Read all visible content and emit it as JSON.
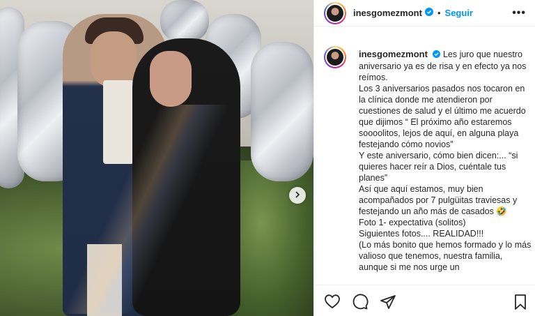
{
  "post": {
    "username": "inesgomezmont",
    "follow_label": "Seguir",
    "more_label": "•••",
    "verified_icon": "verified-badge-icon",
    "separator": "•"
  },
  "caption": {
    "lines": [
      "Les juro que nuestro aniversario ya es de risa y en efecto ya nos reímos.",
      "Los 3 aniversarios pasados nos tocaron en la clínica donde me atendieron por cuestiones de salud y el último me acuerdo que dijimos “ El próximo año estaremos soooolitos, lejos de aquí, en alguna playa festejando cómo novios”",
      "Y este aniversario, cómo bien dicen:... “si quieres hacer reír a Dios, cuéntale tus planes”",
      "Así que aquí estamos, muy bien acompañados por 7 pulgüitas traviesas y festejando un año más de casados 🤣",
      "Foto 1- expectativa (solitos)",
      "Siguientes fotos.... REALIDAD!!!",
      "(Lo más bonito que hemos formado y lo más valioso que tenemos, nuestra familia, aunque si me nos urge un"
    ]
  },
  "icons": {
    "like": "heart-icon",
    "comment": "comment-icon",
    "share": "send-icon",
    "save": "bookmark-icon",
    "next": "chevron-right-icon"
  },
  "colors": {
    "accent": "#0095f6",
    "text": "#262626",
    "border": "#efefef"
  }
}
